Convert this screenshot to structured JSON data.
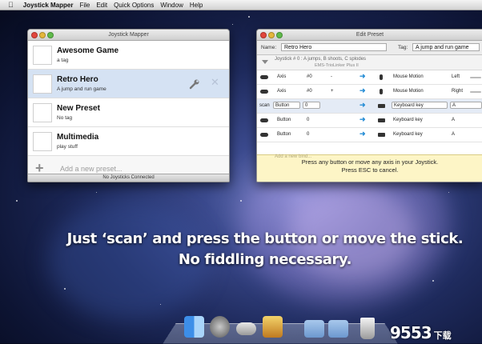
{
  "menubar": {
    "apple": "",
    "app_name": "Joystick Mapper",
    "items": [
      "File",
      "Edit",
      "Quick Options",
      "Window",
      "Help"
    ]
  },
  "mapper_window": {
    "title": "Joystick Mapper",
    "presets": [
      {
        "name": "Awesome Game",
        "tag": "a tag"
      },
      {
        "name": "Retro Hero",
        "tag": "A jump and run game",
        "selected": true
      },
      {
        "name": "New Preset",
        "tag": "No tag"
      },
      {
        "name": "Multimedia",
        "tag": "play stuff"
      }
    ],
    "add_label": "Add a new preset...",
    "status": "No Joysticks Connected"
  },
  "editor_window": {
    "title": "Edit Preset",
    "name_label": "Name:",
    "name_value": "Retro Hero",
    "tag_label": "Tag:",
    "tag_value": "A jump and run game",
    "joystick_line1": "Joystick # 0 :   A jumps, B shoots, C splodes",
    "joystick_line2": "EMS-TrioLinker Plus II",
    "rows": [
      {
        "input": "Axis",
        "num": "#0",
        "sign": "-",
        "output": "Mouse Motion",
        "value": "Left"
      },
      {
        "input": "Axis",
        "num": "#0",
        "sign": "+",
        "output": "Mouse Motion",
        "value": "Right"
      },
      {
        "scan": "scan",
        "input": "Button",
        "num": "0",
        "output": "Keyboard key",
        "value": "A",
        "selected": true
      },
      {
        "input": "Button",
        "num": "0",
        "output": "Keyboard key",
        "value": "A"
      },
      {
        "input": "Button",
        "num": "0",
        "output": "Keyboard key",
        "value": "A"
      }
    ],
    "add_binding": "Add a new bind...",
    "overlay_line1": "Press any button or move any axis in your Joystick.",
    "overlay_line2": "Press ESC to cancel."
  },
  "caption": {
    "line1": "Just ‘scan’ and press the button or move the stick.",
    "line2": "No fiddling necessary."
  },
  "dock": {
    "icons": [
      "finder-icon",
      "launchpad-icon",
      "gamepad-app-icon",
      "joystick-mapper-icon",
      "folder-icon",
      "downloads-folder-icon",
      "trash-icon"
    ]
  },
  "watermark": {
    "text": "9553",
    "cn": "下载"
  },
  "colors": {
    "selection": "#d5e2f3",
    "accent_arrow": "#2a8fd6",
    "overlay": "#fdf5c4"
  }
}
